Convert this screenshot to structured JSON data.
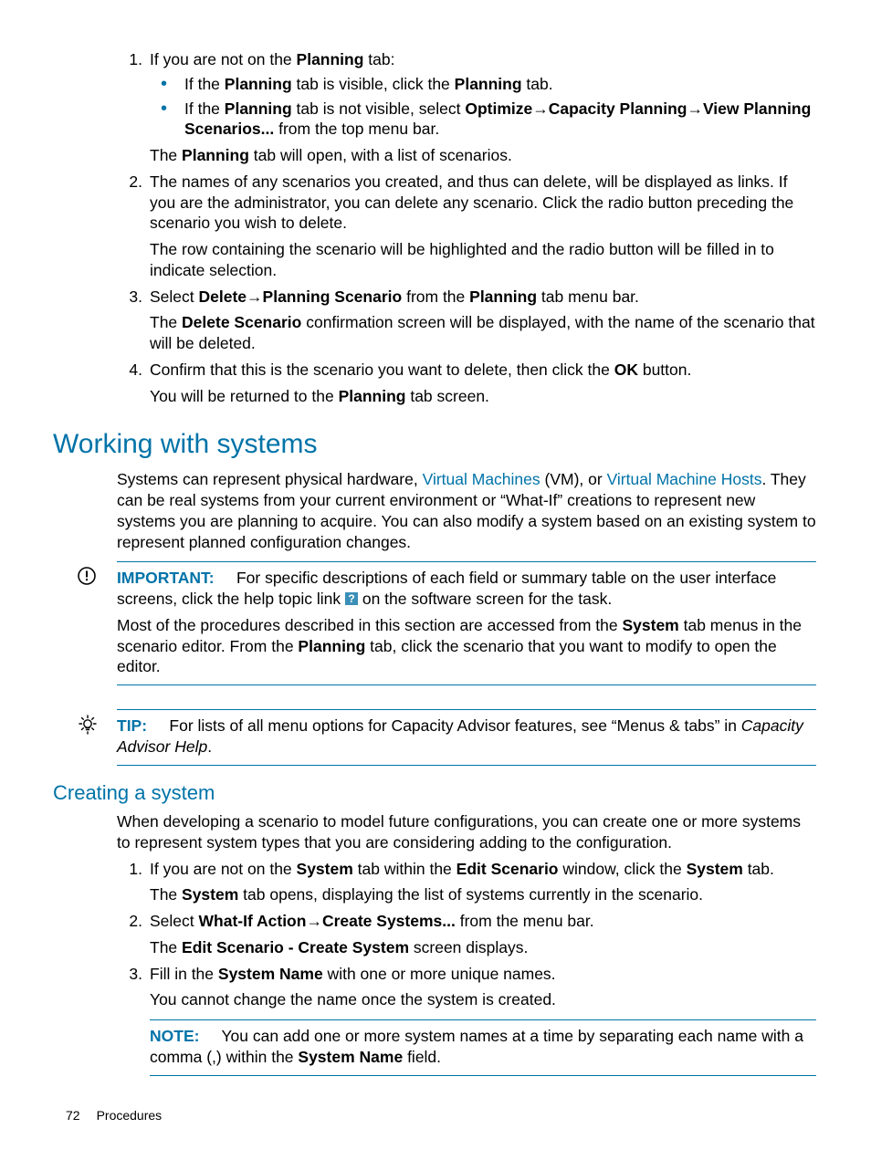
{
  "steps_a": {
    "1": {
      "intro_a": "If you are not on the ",
      "intro_b": "Planning",
      "intro_c": " tab:",
      "bul1_a": "If the ",
      "bul1_b": "Planning",
      "bul1_c": " tab is visible, click the ",
      "bul1_d": "Planning",
      "bul1_e": " tab.",
      "bul2_a": "If the ",
      "bul2_b": "Planning",
      "bul2_c": " tab is not visible, select ",
      "bul2_d": "Optimize",
      "bul2_e": "Capacity Planning",
      "bul2_f": "View Planning Scenarios...",
      "bul2_g": " from the top menu bar.",
      "after_a": "The ",
      "after_b": "Planning",
      "after_c": " tab will open, with a list of scenarios."
    },
    "2": {
      "p1": "The names of any scenarios you created, and thus can delete, will be displayed as links. If you are the administrator, you can delete any scenario. Click the radio button preceding the scenario you wish to delete.",
      "p2": "The row containing the scenario will be highlighted and the radio button will be filled in to indicate selection."
    },
    "3": {
      "a": "Select ",
      "b": "Delete",
      "c": "Planning Scenario",
      "d": " from the ",
      "e": "Planning",
      "f": " tab menu bar.",
      "p2a": "The ",
      "p2b": "Delete Scenario",
      "p2c": " confirmation screen will be displayed, with the name of the scenario that will be deleted."
    },
    "4": {
      "a": "Confirm that this is the scenario you want to delete, then click the ",
      "b": "OK",
      "c": " button.",
      "p2a": "You will be returned to the ",
      "p2b": "Planning",
      "p2c": " tab screen."
    }
  },
  "h1": "Working with systems",
  "intro": {
    "a": "Systems can represent physical hardware, ",
    "link1": "Virtual Machines",
    "b": " (VM), or ",
    "link2": "Virtual Machine Hosts",
    "c": ". They can be real systems from your current environment or “What-If” creations to represent new systems you are planning to acquire. You can also modify a system based on an existing system to represent planned configuration changes."
  },
  "important": {
    "label": "IMPORTANT:",
    "a": "For specific descriptions of each field or summary table on the user interface screens, click the help topic link ",
    "help_glyph": "?",
    "b": " on the software screen for the task.",
    "extra_a": "Most of the procedures described in this section are accessed from the ",
    "extra_b": "System",
    "extra_c": " tab menus in the scenario editor. From the ",
    "extra_d": "Planning",
    "extra_e": " tab, click the scenario that you want to modify to open the editor."
  },
  "tip": {
    "label": "TIP:",
    "a": "For lists of all menu options for Capacity Advisor features, see “Menus & tabs” in ",
    "b": "Capacity Advisor Help",
    "c": "."
  },
  "h2": "Creating a system",
  "h2_intro": "When developing a scenario to model future configurations, you can create one or more systems to represent system types that you are considering adding to the configuration.",
  "steps_b": {
    "1": {
      "a": "If you are not on the ",
      "b": "System",
      "c": " tab within the ",
      "d": "Edit Scenario",
      "e": " window, click the ",
      "f": "System",
      "g": " tab.",
      "p2a": "The ",
      "p2b": "System",
      "p2c": " tab opens, displaying the list of systems currently in the scenario."
    },
    "2": {
      "a": "Select ",
      "b": "What-If Action",
      "c": "Create Systems...",
      "d": " from the menu bar.",
      "p2a": "The ",
      "p2b": "Edit Scenario - Create System",
      "p2c": " screen displays."
    },
    "3": {
      "a": "Fill in the ",
      "b": "System Name",
      "c": " with one or more unique names.",
      "p2": "You cannot change the name once the system is created.",
      "note_label": "NOTE:",
      "note_a": "You can add one or more system names at a time by separating each name with a comma (,) within the ",
      "note_b": "System Name",
      "note_c": " field."
    }
  },
  "footer": {
    "page": "72",
    "section": "Procedures"
  },
  "arrow": "→"
}
